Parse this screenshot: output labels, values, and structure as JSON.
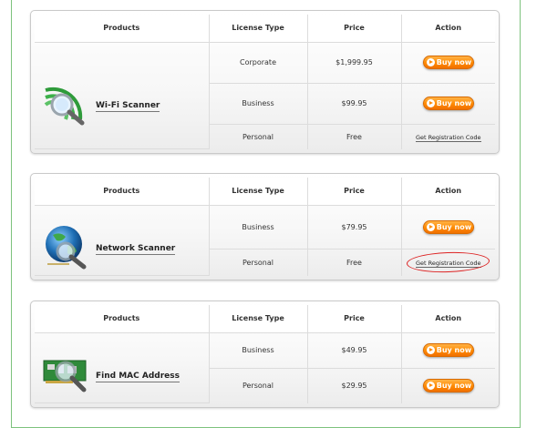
{
  "headers": {
    "products": "Products",
    "license": "License Type",
    "price": "Price",
    "action": "Action"
  },
  "actions": {
    "buy": "Buy now",
    "register": "Get Registration Code"
  },
  "colors": {
    "accent_orange": "#ff8a00",
    "page_border": "#7dc27d",
    "annotation_red": "#dd2222"
  },
  "products": [
    {
      "name": "Wi-Fi Scanner",
      "icon": "wifi-magnifier-icon",
      "rows": [
        {
          "license": "Corporate",
          "price": "$1,999.95",
          "action": "buy"
        },
        {
          "license": "Business",
          "price": "$99.95",
          "action": "buy"
        },
        {
          "license": "Personal",
          "price": "Free",
          "action": "register"
        }
      ]
    },
    {
      "name": "Network Scanner",
      "icon": "globe-magnifier-icon",
      "rows": [
        {
          "license": "Business",
          "price": "$79.95",
          "action": "buy"
        },
        {
          "license": "Personal",
          "price": "Free",
          "action": "register"
        }
      ]
    },
    {
      "name": "Find MAC Address",
      "icon": "network-card-magnifier-icon",
      "rows": [
        {
          "license": "Business",
          "price": "$49.95",
          "action": "buy"
        },
        {
          "license": "Personal",
          "price": "$29.95",
          "action": "buy"
        }
      ]
    }
  ]
}
